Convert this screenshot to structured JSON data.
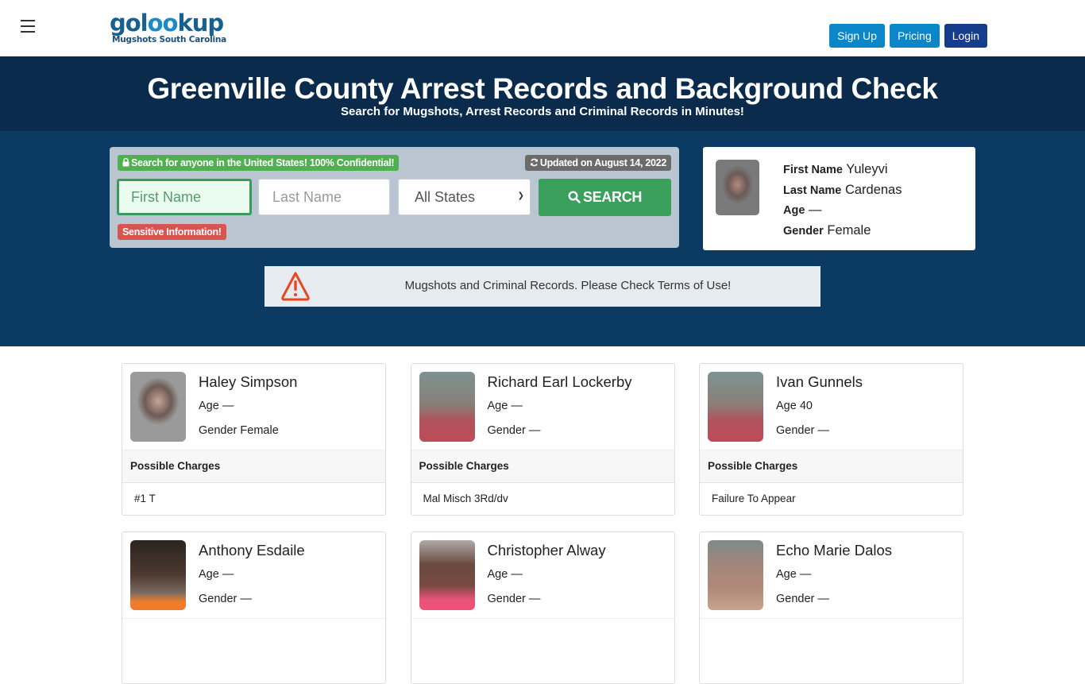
{
  "header": {
    "logo_main_left": "gol",
    "logo_main_mid": "oo",
    "logo_main_right": "kup",
    "logo_sub": "Mugshots South Carolina",
    "menu_icon": "hamburger-icon",
    "buttons": {
      "signup": "Sign Up",
      "pricing": "Pricing",
      "login": "Login"
    }
  },
  "hero": {
    "title": "Greenville County Arrest Records and Background Check",
    "subtitle": "Search for Mugshots, Arrest Records and Criminal Records in Minutes!"
  },
  "search": {
    "confidential_badge": "Search for anyone in the United States! 100% Confidential!",
    "updated_badge": "Updated on August 14, 2022",
    "first_name_placeholder": "First Name",
    "first_name_value": "",
    "last_name_placeholder": "Last Name",
    "last_name_value": "",
    "state_selected": "All States",
    "search_button": "SEARCH",
    "sensitive_badge": "Sensitive Information!"
  },
  "featured": {
    "first_name_label": "First Name",
    "first_name": "Yuleyvi",
    "last_name_label": "Last Name",
    "last_name": "Cardenas",
    "age_label": "Age",
    "age": "—",
    "gender_label": "Gender",
    "gender": "Female"
  },
  "notice": {
    "icon": "warning-icon",
    "text": "Mugshots and Criminal Records. Please Check Terms of Use!",
    "color": "#e8461e"
  },
  "labels": {
    "age": "Age",
    "gender": "Gender",
    "possible_charges": "Possible Charges"
  },
  "records": [
    {
      "name": "Haley Simpson",
      "age": "—",
      "gender": "Female",
      "charges": "#1 T"
    },
    {
      "name": "Richard Earl Lockerby",
      "age": "—",
      "gender": "—",
      "charges": "Mal Misch 3Rd/dv"
    },
    {
      "name": "Ivan Gunnels",
      "age": "40",
      "gender": "—",
      "charges": "Failure To Appear"
    },
    {
      "name": "Anthony Esdaile",
      "age": "—",
      "gender": "—",
      "charges": ""
    },
    {
      "name": "Christopher Alway",
      "age": "—",
      "gender": "—",
      "charges": ""
    },
    {
      "name": "Echo Marie Dalos",
      "age": "—",
      "gender": "—",
      "charges": ""
    }
  ],
  "colors": {
    "header_dark": "#0a2b4b",
    "hero_blue": "#0b3b63",
    "primary_button": "#0a86c9",
    "login_button": "#163d8b",
    "search_green": "#3aa05c",
    "confidential_green": "#4eb04f",
    "sensitive_red": "#d9534f"
  }
}
